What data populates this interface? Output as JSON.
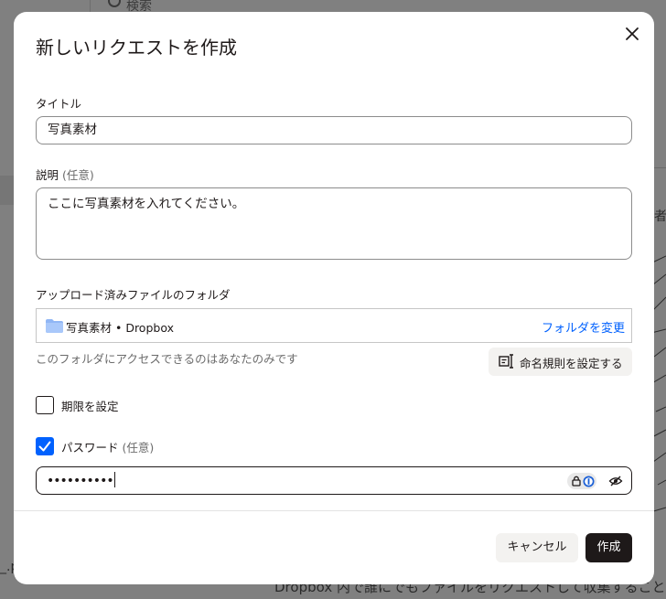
{
  "background": {
    "search_placeholder": "検索",
    "right_text": "者",
    "left_text": "_.p",
    "bottom_text": "Dropbox 内で誰にでもファイルをリクエストして収集することがで"
  },
  "dialog": {
    "title": "新しいリクエストを作成",
    "close_icon": "close-icon",
    "title_field": {
      "label": "タイトル",
      "value": "写真素材"
    },
    "description_field": {
      "label": "説明",
      "optional": "(任意)",
      "value": "ここに写真素材を入れてください。"
    },
    "folder": {
      "label": "アップロード済みファイルのフォルダ",
      "icon": "folder-icon",
      "name": "写真素材 • Dropbox",
      "change_link": "フォルダを変更",
      "note": "このフォルダにアクセスできるのはあなたのみです",
      "naming_button": "命名規則を設定する"
    },
    "deadline": {
      "label": "期限を設定",
      "checked": false
    },
    "password": {
      "label": "パスワード",
      "optional": "(任意)",
      "checked": true,
      "value": "••••••••••"
    },
    "buttons": {
      "cancel": "キャンセル",
      "create": "作成"
    },
    "colors": {
      "accent": "#0061fe",
      "primary_button": "#1e1919",
      "secondary_button": "#f3f2f0",
      "overlay": "#808080"
    }
  }
}
